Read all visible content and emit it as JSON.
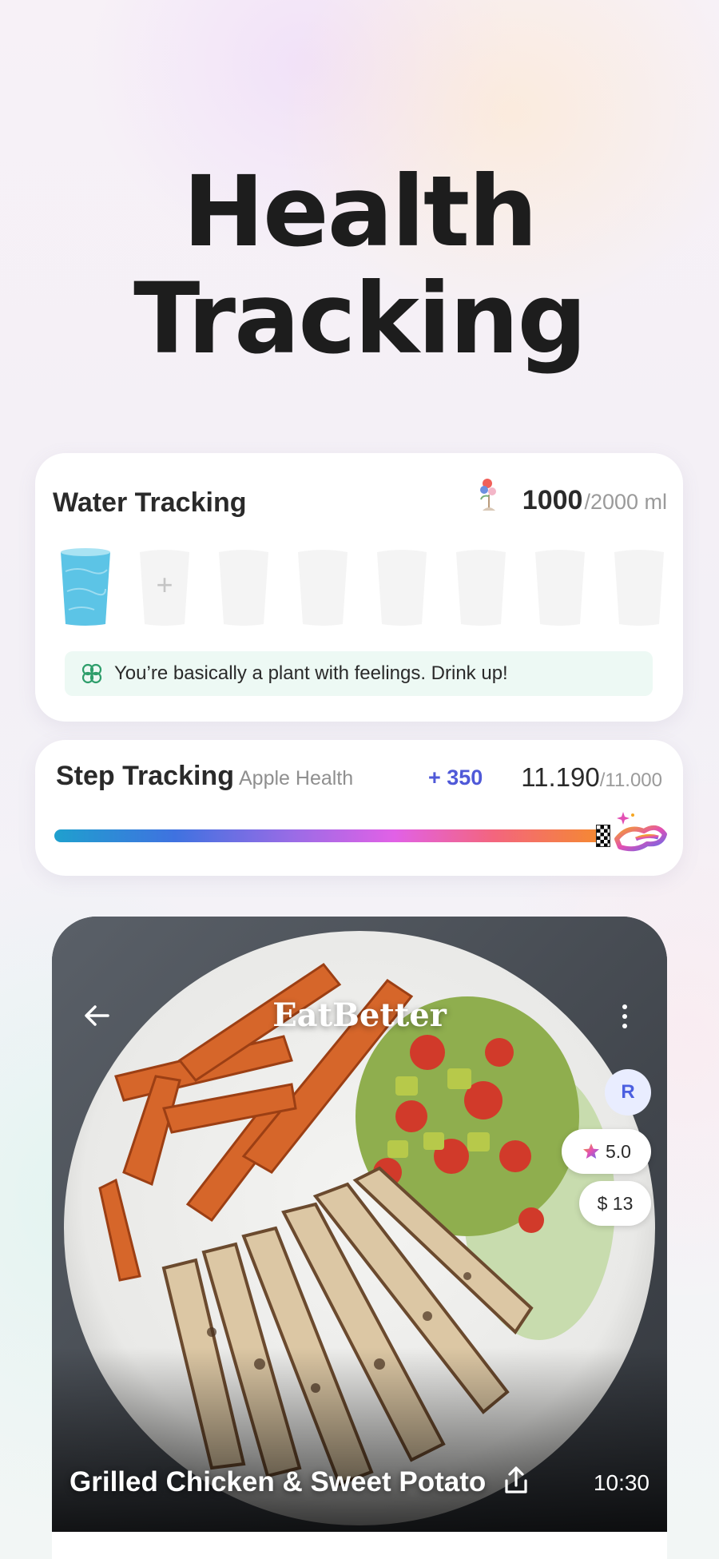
{
  "hero": {
    "title_line1": "Health",
    "title_line2": "Tracking"
  },
  "water": {
    "title": "Water Tracking",
    "current": "1000",
    "goal": "/2000 ml",
    "glasses_filled": 1,
    "glasses_total": 8,
    "add_symbol": "+",
    "tip": "You’re basically a plant with feelings. Drink up!"
  },
  "steps": {
    "title": "Step Tracking",
    "source": "Apple Health",
    "delta": "+ 350",
    "current": "11.190",
    "goal": "/11.000",
    "progress": 1.0
  },
  "food": {
    "brand": "EatBetter",
    "avatar_initial": "R",
    "rating": "5.0",
    "price": "$ 13",
    "name": "Grilled Chicken & Sweet Potato",
    "time": "10:30"
  },
  "colors": {
    "accent_blue": "#4f59d8",
    "water_blue": "#5cc4e6",
    "tip_bg": "#edf9f4",
    "tip_icon": "#2e9e6b"
  },
  "icons": [
    "plant-icon",
    "clover-icon",
    "shoe-icon",
    "finish-flag-icon",
    "back-arrow-icon",
    "more-icon",
    "star-icon",
    "share-icon"
  ]
}
